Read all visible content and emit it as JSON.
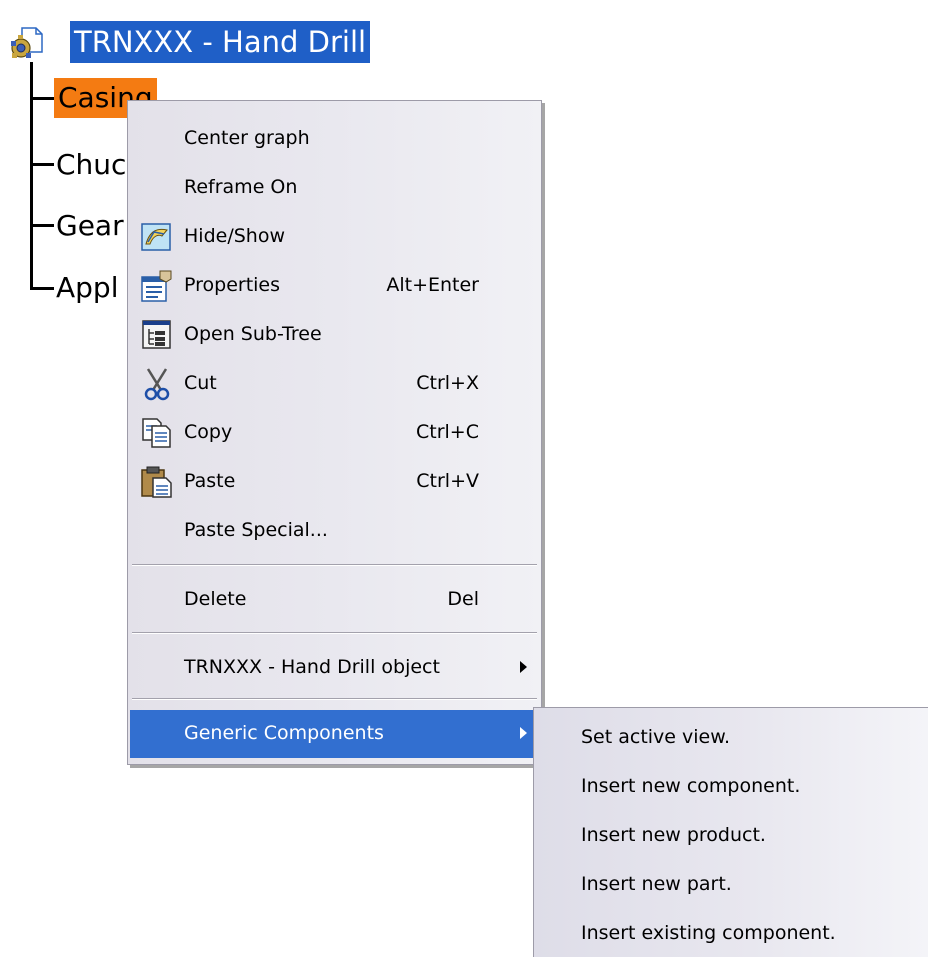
{
  "tree": {
    "root_label": "TRNXXX - Hand Drill",
    "nodes": [
      {
        "label": "Casing",
        "selected": true
      },
      {
        "label": "Chuc"
      },
      {
        "label": "Gear"
      },
      {
        "label": "Appl"
      }
    ]
  },
  "context_menu": {
    "items": [
      {
        "label": "Center graph"
      },
      {
        "label": "Reframe On"
      },
      {
        "label": "Hide/Show",
        "icon": "hide-show-icon"
      },
      {
        "label": "Properties",
        "shortcut": "Alt+Enter",
        "icon": "properties-icon"
      },
      {
        "label": "Open Sub-Tree",
        "icon": "open-sub-tree-icon"
      },
      {
        "label": "Cut",
        "shortcut": "Ctrl+X",
        "icon": "scissors-icon"
      },
      {
        "label": "Copy",
        "shortcut": "Ctrl+C",
        "icon": "copy-icon"
      },
      {
        "label": "Paste",
        "shortcut": "Ctrl+V",
        "icon": "paste-icon"
      },
      {
        "label": "Paste Special..."
      },
      {
        "label": "Delete",
        "shortcut": "Del"
      },
      {
        "label": "TRNXXX - Hand Drill object",
        "submenu": true
      },
      {
        "label": "Generic Components",
        "submenu": true,
        "highlighted": true
      }
    ]
  },
  "submenu": {
    "items": [
      {
        "label": "Set active view."
      },
      {
        "label": "Insert new component."
      },
      {
        "label": "Insert new product."
      },
      {
        "label": "Insert new part."
      },
      {
        "label": "Insert existing component."
      }
    ]
  },
  "colors": {
    "selection_blue": "#326fd0",
    "root_highlight": "#1f5fc7",
    "selected_node_orange": "#f47b12"
  }
}
